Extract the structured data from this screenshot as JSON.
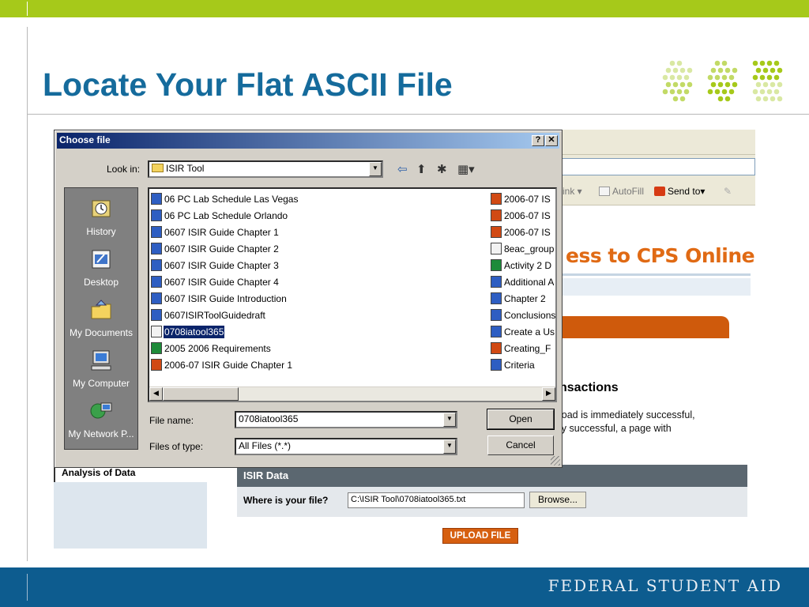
{
  "slide": {
    "title": "Locate Your Flat ASCII File",
    "footer": "FEDERAL STUDENT AID"
  },
  "colors": {
    "accent_green": "#a6c91a",
    "title_blue": "#156b9c",
    "footer_blue": "#0d5c8f",
    "cps_orange": "#e06a14"
  },
  "browser": {
    "toolbar": {
      "link_fragment": "ink",
      "autofill_label": "AutoFill",
      "send_to_label": "Send to"
    },
    "page_heading_fragment": "ess to CPS Online",
    "section_heading_fragment": "nsactions",
    "upload_line1": "load is immediately successful,",
    "upload_line2": "ly successful, a page with",
    "left_panel_header": "Analysis of Data",
    "isir_box": {
      "header": "ISIR Data",
      "where_label": "Where is your file?",
      "file_path": "C:\\ISIR Tool\\0708iatool365.txt",
      "browse_label": "Browse..."
    },
    "upload_button": "UPLOAD FILE"
  },
  "dialog": {
    "title": "Choose file",
    "help_label": "?",
    "close_label": "✕",
    "look_in_label": "Look in:",
    "look_in_value": "ISIR Tool",
    "places": [
      {
        "label": "History",
        "icon": "history-icon"
      },
      {
        "label": "Desktop",
        "icon": "desktop-icon"
      },
      {
        "label": "My Documents",
        "icon": "my-documents-icon"
      },
      {
        "label": "My Computer",
        "icon": "my-computer-icon"
      },
      {
        "label": "My Network P...",
        "icon": "network-places-icon"
      }
    ],
    "files_left": [
      {
        "name": "06 PC Lab Schedule Las Vegas",
        "type": "word"
      },
      {
        "name": "06 PC Lab Schedule Orlando",
        "type": "word"
      },
      {
        "name": "0607 ISIR Guide Chapter 1",
        "type": "word"
      },
      {
        "name": "0607 ISIR Guide Chapter 2",
        "type": "word"
      },
      {
        "name": "0607 ISIR Guide Chapter 3",
        "type": "word"
      },
      {
        "name": "0607 ISIR Guide Chapter 4",
        "type": "word"
      },
      {
        "name": "0607 ISIR Guide Introduction",
        "type": "word"
      },
      {
        "name": "0607ISIRToolGuidedraft",
        "type": "word"
      },
      {
        "name": "0708iatool365",
        "type": "txt",
        "selected": true
      },
      {
        "name": "2005 2006 Requirements",
        "type": "excel"
      },
      {
        "name": "2006-07 ISIR Guide Chapter 1",
        "type": "ppt"
      }
    ],
    "files_right": [
      {
        "name": "2006-07 IS",
        "type": "ppt"
      },
      {
        "name": "2006-07 IS",
        "type": "ppt"
      },
      {
        "name": "2006-07 IS",
        "type": "ppt"
      },
      {
        "name": "8eac_group",
        "type": "txt"
      },
      {
        "name": "Activity 2 D",
        "type": "excel"
      },
      {
        "name": "Additional A",
        "type": "word"
      },
      {
        "name": "Chapter 2",
        "type": "word"
      },
      {
        "name": "Conclusions",
        "type": "word"
      },
      {
        "name": "Create a Us",
        "type": "word"
      },
      {
        "name": "Creating_F",
        "type": "ppt"
      },
      {
        "name": "Criteria",
        "type": "word"
      }
    ],
    "file_name_label": "File name:",
    "file_name_value": "0708iatool365",
    "file_type_label": "Files of type:",
    "file_type_value": "All Files (*.*)",
    "open_label": "Open",
    "cancel_label": "Cancel"
  }
}
